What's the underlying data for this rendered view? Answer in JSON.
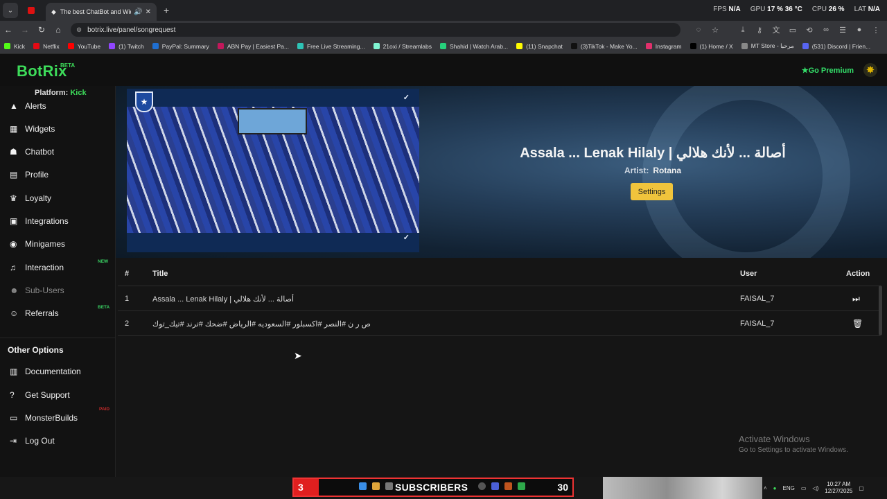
{
  "browser": {
    "tab_title": "The best ChatBot and Widg",
    "url": "botrix.live/panel/songrequest",
    "stats": {
      "fps_label": "FPS",
      "fps": "N/A",
      "gpu_label": "GPU",
      "gpu": "17 % 36 °C",
      "cpu_label": "CPU",
      "cpu": "26 %",
      "lat_label": "LAT",
      "lat": "N/A"
    },
    "bookmarks": [
      {
        "label": "Kick",
        "color": "#53fc18"
      },
      {
        "label": "Netflix",
        "color": "#e50914"
      },
      {
        "label": "YouTube",
        "color": "#ff0000"
      },
      {
        "label": "(1) Twitch",
        "color": "#9146ff"
      },
      {
        "label": "PayPal: Summary",
        "color": "#1f6fd1"
      },
      {
        "label": "ABN Pay | Easiest Pa...",
        "color": "#c2185b"
      },
      {
        "label": "Free Live Streaming...",
        "color": "#2ec4b6"
      },
      {
        "label": "21oxi / Streamlabs",
        "color": "#80f5d2"
      },
      {
        "label": "Shahid | Watch Arab...",
        "color": "#26d07c"
      },
      {
        "label": "(11) Snapchat",
        "color": "#fffc00"
      },
      {
        "label": "(3)TikTok - Make Yo...",
        "color": "#111111"
      },
      {
        "label": "Instagram",
        "color": "#e1306c"
      },
      {
        "label": "(1) Home / X",
        "color": "#000000"
      },
      {
        "label": "MT Store - مرحبا",
        "color": "#888888"
      },
      {
        "label": "(531) Discord | Frien...",
        "color": "#5865f2"
      }
    ]
  },
  "app": {
    "logo": "BotRix",
    "logo_badge": "BETA",
    "premium_label": "Go Premium",
    "accent": "#3ddc5a"
  },
  "sidebar": {
    "platform_label": "Platform:",
    "platform_value": "Kick",
    "items": [
      {
        "label": "Alerts",
        "icon": "warning-icon"
      },
      {
        "label": "Widgets",
        "icon": "table-icon"
      },
      {
        "label": "Chatbot",
        "icon": "robot-icon"
      },
      {
        "label": "Profile",
        "icon": "id-card-icon"
      },
      {
        "label": "Loyalty",
        "icon": "trophy-icon"
      },
      {
        "label": "Integrations",
        "icon": "integration-icon"
      },
      {
        "label": "Minigames",
        "icon": "gamepad-icon"
      },
      {
        "label": "Interaction",
        "icon": "music-icon",
        "badge": "NEW"
      },
      {
        "label": "Sub-Users",
        "icon": "users-icon"
      },
      {
        "label": "Referrals",
        "icon": "referral-icon",
        "badge": "BETA"
      }
    ],
    "other_title": "Other Options",
    "other_items": [
      {
        "label": "Documentation",
        "icon": "book-icon"
      },
      {
        "label": "Get Support",
        "icon": "question-icon"
      },
      {
        "label": "MonsterBuilds",
        "icon": "laptop-icon",
        "badge": "PAID"
      },
      {
        "label": "Log Out",
        "icon": "logout-icon"
      }
    ]
  },
  "now_playing": {
    "title": "Assala ... Lenak Hilaly | أصالة ... لأنك هلالي",
    "artist_label": "Artist:",
    "artist": "Rotana",
    "settings_label": "Settings"
  },
  "queue": {
    "headers": {
      "num": "#",
      "title": "Title",
      "user": "User",
      "action": "Action"
    },
    "rows": [
      {
        "num": "1",
        "title": "Assala ... Lenak Hilaly | أصالة ... لأنك هلالي",
        "user": "FAISAL_7",
        "action_icon": "skip-forward-icon"
      },
      {
        "num": "2",
        "title": "ص ر ن #النصر #اكسبلور #السعوديه #الرياض #ضحك #ترند #تيك_توك",
        "user": "FAISAL_7",
        "action_icon": "trash-icon"
      }
    ]
  },
  "windows_notice": {
    "line1": "Activate Windows",
    "line2": "Go to Settings to activate Windows."
  },
  "taskbar": {
    "sub_count": "3",
    "sub_label": "SUBSCRIBERS",
    "sub_total": "30",
    "lang": "ENG",
    "time": "10:27 AM",
    "date": "12/27/2025"
  }
}
